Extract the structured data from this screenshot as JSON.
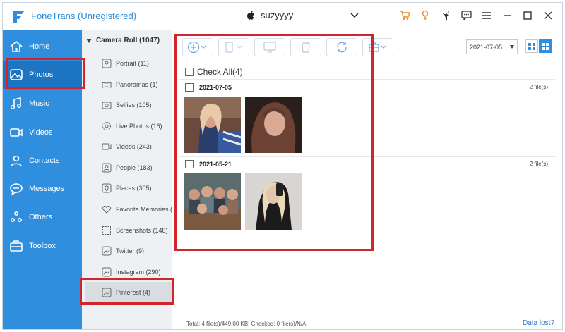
{
  "app": {
    "title": "FoneTrans (Unregistered)"
  },
  "device": {
    "name": "suzyyyy"
  },
  "window_icons": [
    "cart-icon",
    "key-icon",
    "facebook-icon",
    "chat-icon",
    "menu-icon",
    "minimize-icon",
    "maximize-icon",
    "close-icon"
  ],
  "nav": {
    "items": [
      {
        "label": "Home",
        "icon": "home-icon"
      },
      {
        "label": "Photos",
        "icon": "photos-icon",
        "active": true
      },
      {
        "label": "Music",
        "icon": "music-icon"
      },
      {
        "label": "Videos",
        "icon": "video-icon"
      },
      {
        "label": "Contacts",
        "icon": "contacts-icon"
      },
      {
        "label": "Messages",
        "icon": "messages-icon"
      },
      {
        "label": "Others",
        "icon": "others-icon"
      },
      {
        "label": "Toolbox",
        "icon": "toolbox-icon"
      }
    ]
  },
  "albums": {
    "header": "Camera Roll (1047)",
    "items": [
      {
        "label": "Portrait (11)"
      },
      {
        "label": "Panoramas (1)"
      },
      {
        "label": "Selfies (105)"
      },
      {
        "label": "Live Photos (16)"
      },
      {
        "label": "Videos (243)"
      },
      {
        "label": "People (183)"
      },
      {
        "label": "Places (305)"
      },
      {
        "label": "Favorite Memories (..."
      },
      {
        "label": "Screenshots (148)"
      },
      {
        "label": "Twitter (9)"
      },
      {
        "label": "Instagram (290)"
      },
      {
        "label": "Pinterest (4)",
        "active": true
      }
    ]
  },
  "toolbar": {
    "buttons": [
      "add-button",
      "export-to-device-button",
      "export-to-pc-button",
      "delete-button",
      "refresh-button",
      "toolbox-button"
    ]
  },
  "date_filter": {
    "value": "2021-07-05"
  },
  "main": {
    "check_all": "Check All(4)",
    "groups": [
      {
        "date": "2021-07-05",
        "count": "2 file(s)"
      },
      {
        "date": "2021-05-21",
        "count": "2 file(s)"
      }
    ],
    "status": "Total: 4 file(s)/449.00 KB; Checked: 0 file(s)/N/A",
    "data_lost": "Data lost?"
  },
  "colors": {
    "nav_bg": "#2f8fde",
    "nav_active": "#1d74c2",
    "highlight": "#d0252d",
    "brand": "#2a8ad9"
  }
}
